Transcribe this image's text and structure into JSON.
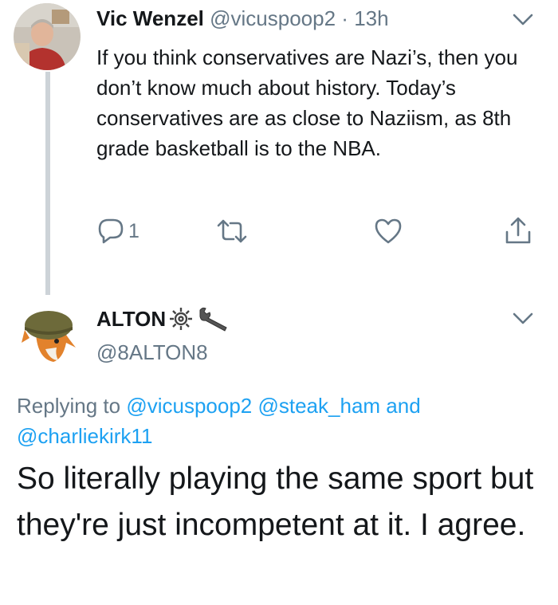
{
  "tweet1": {
    "display_name": "Vic Wenzel",
    "handle": "@vicuspoop2",
    "separator": "·",
    "time": "13h",
    "text": "If you think conservatives are Nazi’s, then you don’t know much about history. Today’s conservatives are as close to Naziism, as 8th grade basketball is to the NBA.",
    "reply_count": "1",
    "icons": {
      "menu": "chevron-down-icon",
      "reply": "reply-icon",
      "retweet": "retweet-icon",
      "like": "heart-icon",
      "share": "share-icon"
    }
  },
  "tweet2": {
    "display_name": "ALTON",
    "name_emoji": [
      "gear-icon",
      "wrench-icon"
    ],
    "handle": "@8ALTON8",
    "replying_prefix": "Replying to",
    "replying_mention1": "@vicuspoop2",
    "replying_mention2": "@steak_ham",
    "replying_and": "and",
    "replying_mention3": "@charliekirk11",
    "text": "So literally playing the same sport but they're just incompetent at it. I agree.",
    "icons": {
      "menu": "chevron-down-icon"
    }
  },
  "colors": {
    "text": "#14171a",
    "muted": "#657786",
    "link": "#1da1f2",
    "thread_line": "#cdd3d8"
  }
}
